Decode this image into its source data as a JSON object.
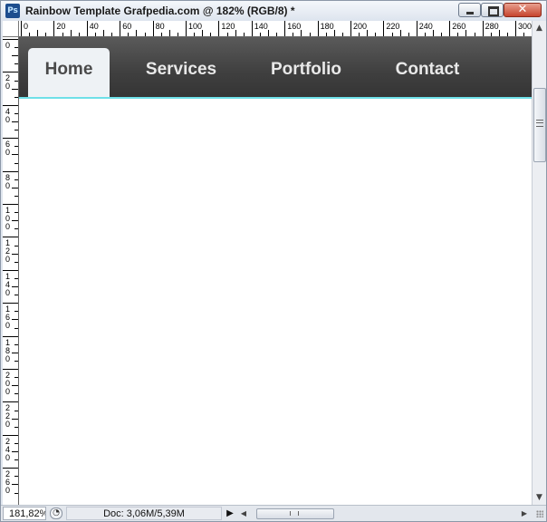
{
  "window": {
    "app_icon_text": "Ps",
    "title": "Rainbow Template Grafpedia.com @ 182% (RGB/8) *",
    "minimize_label": "",
    "maximize_label": "",
    "close_glyph": "✕"
  },
  "rulers": {
    "horizontal_labels": [
      "0",
      "20",
      "40",
      "60",
      "80",
      "100",
      "120",
      "140",
      "160",
      "180",
      "200",
      "220",
      "240",
      "260",
      "280",
      "300"
    ],
    "vertical_labels": [
      [
        "0"
      ],
      [
        "2",
        "0"
      ],
      [
        "4",
        "0"
      ],
      [
        "6",
        "0"
      ],
      [
        "8",
        "0"
      ],
      [
        "1",
        "0",
        "0"
      ],
      [
        "1",
        "2",
        "0"
      ],
      [
        "1",
        "4",
        "0"
      ],
      [
        "1",
        "6",
        "0"
      ],
      [
        "1",
        "8",
        "0"
      ],
      [
        "2",
        "0",
        "0"
      ],
      [
        "2",
        "2",
        "0"
      ],
      [
        "2",
        "4",
        "0"
      ],
      [
        "2",
        "6",
        "0"
      ]
    ]
  },
  "canvas": {
    "navbar": {
      "items": [
        {
          "label": "Home",
          "active": true
        },
        {
          "label": "Services",
          "active": false
        },
        {
          "label": "Portfolio",
          "active": false
        },
        {
          "label": "Contact",
          "active": false
        }
      ],
      "accent_color": "#6ee0e8"
    }
  },
  "statusbar": {
    "zoom": "181,82%",
    "doc_info": "Doc: 3,06M/5,39M",
    "play_glyph": "▶"
  },
  "icons": {
    "app": "photoshop-icon",
    "minimize": "minimize-icon",
    "maximize": "maximize-icon",
    "close": "close-icon",
    "zoom": "zoom-icon"
  }
}
